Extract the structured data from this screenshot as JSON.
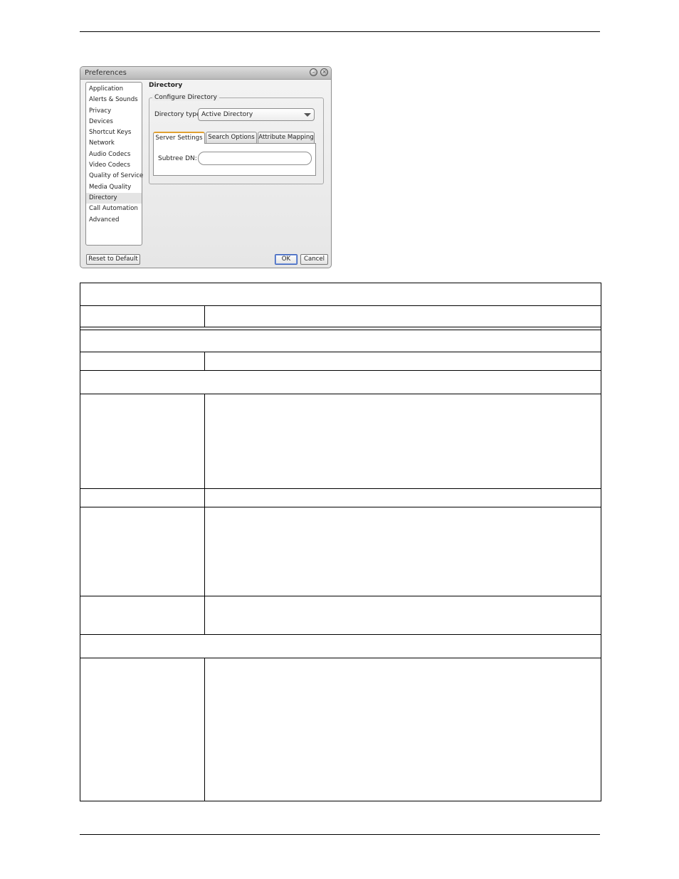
{
  "dialog": {
    "title": "Preferences",
    "nav_items": [
      "Application",
      "Alerts & Sounds",
      "Privacy",
      "Devices",
      "Shortcut Keys",
      "Network",
      "Audio Codecs",
      "Video Codecs",
      "Quality of Service",
      "Media Quality",
      "Directory",
      "Call Automation",
      "Advanced"
    ],
    "selected_item": "Directory",
    "pane_title": "Directory",
    "group_title": "Configure Directory",
    "directory_type_label": "Directory type:",
    "directory_type_value": "Active Directory",
    "tabs": [
      "Server Settings",
      "Search Options",
      "Attribute Mapping"
    ],
    "active_tab": "Server Settings",
    "subtree_label": "Subtree DN:",
    "subtree_value": "",
    "buttons": {
      "reset": "Reset to Default",
      "ok": "OK",
      "cancel": "Cancel"
    }
  }
}
